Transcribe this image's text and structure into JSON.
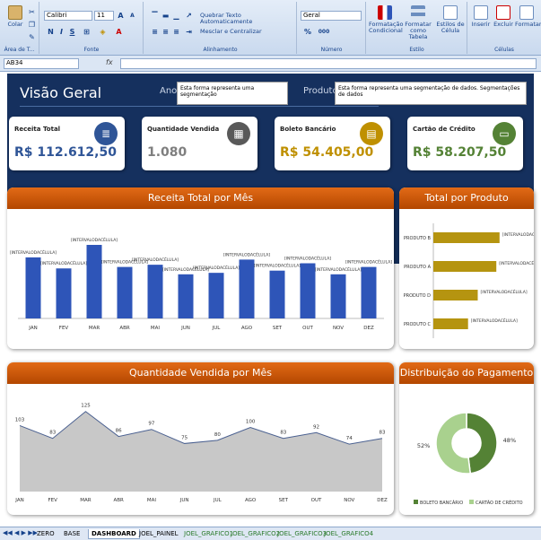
{
  "ribbon": {
    "clipboard": {
      "paste": "Colar",
      "group": "Área de T..."
    },
    "font": {
      "name": "Calibri",
      "size": "11",
      "bold": "N",
      "italic": "I",
      "underline": "S",
      "group": "Fonte",
      "grow": "A",
      "shrink": "A"
    },
    "alignment": {
      "wrap": "Quebrar Texto Automaticamente",
      "merge": "Mesclar e Centralizar",
      "group": "Alinhamento"
    },
    "number": {
      "format": "Geral",
      "percent": "%",
      "thousands": "000",
      "group": "Número"
    },
    "style": {
      "conditional": "Formatação Condicional",
      "table": "Formatar como Tabela",
      "cell": "Estilos de Célula",
      "group": "Estilo"
    },
    "cells": {
      "insert": "Inserir",
      "delete": "Excluir",
      "format": "Formatar",
      "group": "Células"
    }
  },
  "formula_bar": {
    "cell": "AB34",
    "fx": "fx"
  },
  "dashboard": {
    "title": "Visão Geral",
    "filter_year_label": "Ano",
    "filter_year_slicer": "Esta forma representa uma segmentação",
    "filter_product_label": "Produto",
    "filter_product_slicer": "Esta forma representa uma segmentação de dados. Segmentações de dados"
  },
  "kpis": [
    {
      "label": "Receita Total",
      "value": "R$ 112.612,50",
      "color": "#2f5597",
      "icon": "database-icon",
      "glyph": "≣"
    },
    {
      "label": "Quantidade Vendida",
      "value": "1.080",
      "color": "#7f7f7f",
      "icon": "grid-icon",
      "glyph": "▦"
    },
    {
      "label": "Boleto Bancário",
      "value": "R$ 54.405,00",
      "color": "#bf9000",
      "icon": "document-icon",
      "glyph": "▤"
    },
    {
      "label": "Cartão de Crédito",
      "value": "R$ 58.207,50",
      "color": "#548235",
      "icon": "card-icon",
      "glyph": "▭"
    }
  ],
  "placeholder": "[INTERVALODACÉLULA]",
  "revenue_panel": {
    "title": "Receita Total por Mês"
  },
  "product_panel": {
    "title": "Total por Produto"
  },
  "qty_panel": {
    "title": "Quantidade Vendida por Mês"
  },
  "payment_panel": {
    "title": "Distribuição do Pagamento"
  },
  "chart_data": [
    {
      "type": "bar",
      "title": "Receita Total por Mês",
      "categories": [
        "JAN",
        "FEV",
        "MAR",
        "ABR",
        "MAI",
        "JUN",
        "JUL",
        "AGO",
        "SET",
        "OUT",
        "NOV",
        "DEZ"
      ],
      "values": [
        0.83,
        0.68,
        1.0,
        0.7,
        0.73,
        0.6,
        0.62,
        0.8,
        0.65,
        0.75,
        0.6,
        0.7
      ],
      "ylim": [
        0,
        1
      ],
      "color": "#2e55b8"
    },
    {
      "type": "bar",
      "orientation": "horizontal",
      "title": "Total por Produto",
      "categories": [
        "PRODUTO B",
        "PRODUTO A",
        "PRODUTO D",
        "PRODUTO C"
      ],
      "values": [
        0.82,
        0.78,
        0.55,
        0.43
      ],
      "ylim": [
        0,
        1
      ],
      "color": "#b59410"
    },
    {
      "type": "area",
      "title": "Quantidade Vendida por Mês",
      "categories": [
        "JAN",
        "FEV",
        "MAR",
        "ABR",
        "MAI",
        "JUN",
        "JUL",
        "AGO",
        "SET",
        "OUT",
        "NOV",
        "DEZ"
      ],
      "values": [
        103,
        83,
        125,
        86,
        97,
        75,
        80,
        100,
        83,
        92,
        74,
        83
      ],
      "ylim": [
        0,
        140
      ],
      "color": "#c8c8c8"
    },
    {
      "type": "pie",
      "title": "Distribuição do Pagamento",
      "series": [
        {
          "name": "BOLETO BANCÁRIO",
          "value": 48,
          "label": "48%",
          "color": "#548235"
        },
        {
          "name": "CARTÃO DE CRÉDITO",
          "value": 52,
          "label": "52%",
          "color": "#a9d18e"
        }
      ]
    }
  ],
  "sheet_tabs": [
    "ZERO",
    "BASE",
    "DASHBOARD",
    "JOEL_PAINEL",
    "JOEL_GRAFICO1",
    "JOEL_GRAFICO2",
    "JOEL_GRAFICO3",
    "JOEL_GRAFICO4"
  ],
  "active_tab": "DASHBOARD"
}
